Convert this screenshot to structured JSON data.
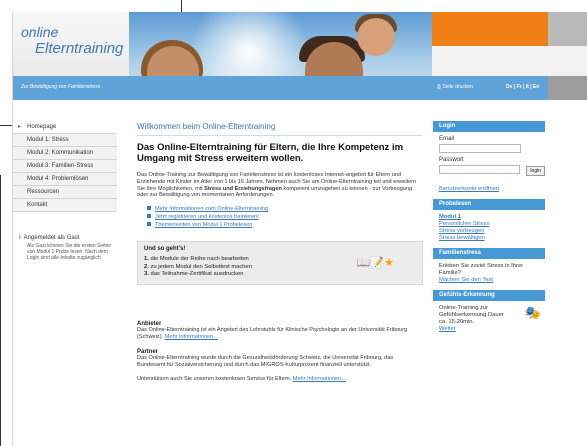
{
  "header": {
    "logo_line1": "online",
    "logo_line2": "Elterntraining",
    "tagline": "Zur Bewältigung von Familienstress",
    "print_label": "Seite drucken",
    "languages": "De | Fr | It | En"
  },
  "nav": {
    "items": [
      {
        "label": "Homepage"
      },
      {
        "label": "Modul 1: Stress"
      },
      {
        "label": "Modul 2: Kommunikation"
      },
      {
        "label": "Modul 3: Familien-Stress"
      },
      {
        "label": "Modul 4: Problemlösen"
      },
      {
        "label": "Ressourcen"
      },
      {
        "label": "Kontakt"
      }
    ],
    "guest_title": "Angemeldet als Gast",
    "guest_text": "Als Gast können Sie die ersten Seiten von Modul 1 Probe lesen. Nach dem Login sind alle Inhalte zugänglich."
  },
  "main": {
    "welcome": "Willkommen beim Online-Elterntraining",
    "headline": "Das Online-Elterntraining für Eltern, die Ihre Kompetenz im Umgang mit Stress erweitern wollen.",
    "intro_a": "Das Online-Training zur Bewältigung von Familienstress ist ein kostenloses Internet-angebot für Eltern und Erziehende mit Kinder im Alter von 1 bis 16 Jahren. Nehmen auch Sie am Online-Elterntraining teil und erweitern Sie Ihre Möglichkeiten, mit ",
    "intro_bold": "Stress und Erziehungsfragen",
    "intro_b": " kompetent umzugehen zu können - zur Vorbeugung oder zur Bewältigung von momentanen Anforderungen.",
    "links": [
      {
        "label": "Mehr Informationen zum Online-Elterntraining"
      },
      {
        "label": "Jetzt registrieren und kostenlos trainieren!"
      },
      {
        "label": "Themenseiten von Modul 1 Probelesen"
      }
    ],
    "steps_title": "Und so geht's!",
    "steps": [
      {
        "num": "1.",
        "text": "die Module der Reihe nach bearbeiten"
      },
      {
        "num": "2.",
        "text": "zu jedem Modul den Selbsttest machen"
      },
      {
        "num": "3.",
        "text": "das Teilnahme-Zertifikat ausdrucken"
      }
    ],
    "provider_title": "Anbieter",
    "provider_text": "Das Online-Elterntraining ist ein Angebot des Lehrstuhls für Klinische Psychologie an der Universität Fribourg (Schweiz). ",
    "provider_link": "Mehr Informationen...",
    "partner_title": "Partner",
    "partner_text": "Das Online-Elterntraining wurde durch die Gesundheitsförderung Schweiz, die Universität Fribourg, das Bundesamt für Sozialversicherung und durch das MIGROS-Kulturprozent finanziell unterstützt.",
    "support_text": "Unterstützen auch Sie unseren kostenlosen Service für Eltern. ",
    "support_link": "Mehr Informationen..."
  },
  "right": {
    "login_title": "Login",
    "email_label": "Email",
    "password_label": "Passwort",
    "login_button": "login",
    "register_link": "Benutzerkonto eröffnen",
    "probe_title": "Probelesen",
    "probe_links": [
      {
        "label": "Modul 1"
      },
      {
        "label": "Persönlicher Stress"
      },
      {
        "label": "Stress vorbeugen"
      },
      {
        "label": "Stress bewältigen"
      }
    ],
    "family_title": "Familienstress",
    "family_text": "Erleben Sie zuviel Stress in Ihrer Familie?",
    "family_link": "Machen Sie den Test",
    "feeling_title": "Gefühls-Erkennung",
    "feeling_text": "Online-Training zur Gefühlserkennung Dauer ca. 15-20min.",
    "feeling_link": "Weiter"
  }
}
